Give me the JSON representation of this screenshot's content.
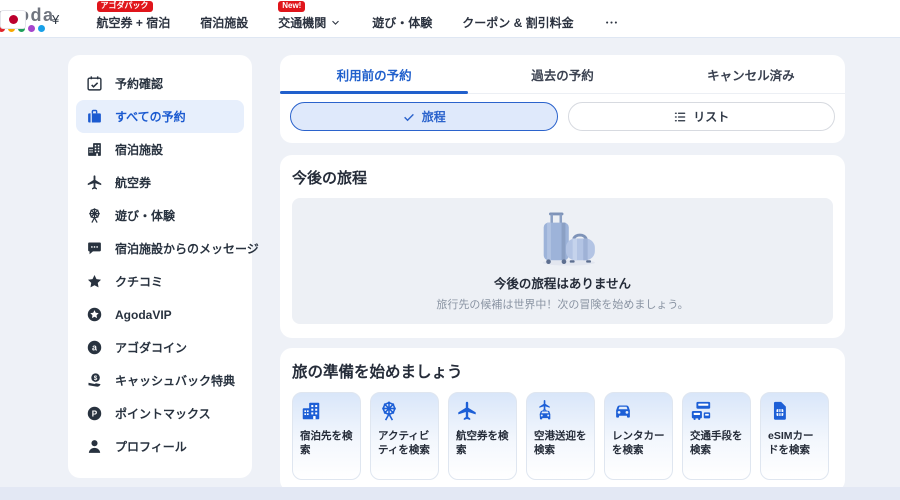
{
  "colors": {
    "accent_blue": "#2160cc",
    "icon_blue": "#1d5fd6",
    "badge_red": "#e0151b",
    "flag_red": "#bc002d",
    "page_bg": "#eef1f7",
    "active_item_bg": "#e7effc",
    "logo_gray": "#70757f",
    "logo_dots": [
      "#e0252c",
      "#f7a800",
      "#1ea05a",
      "#a545cc",
      "#18a0e8"
    ]
  },
  "header": {
    "logo_text": "agoda",
    "nav": [
      {
        "id": "flight-hotel",
        "label": "航空券 + 宿泊",
        "badge": "アゴダパック"
      },
      {
        "id": "hotels",
        "label": "宿泊施設"
      },
      {
        "id": "transport",
        "label": "交通機関",
        "badge": "New!",
        "chevron": true
      },
      {
        "id": "activities",
        "label": "遊び・体験"
      },
      {
        "id": "coupons",
        "label": "クーポン & 割引料金"
      },
      {
        "id": "more",
        "label": "",
        "icon": "more-dots"
      }
    ],
    "locale": {
      "flag": "japan",
      "currency": "¥"
    }
  },
  "sidebar": {
    "items": [
      {
        "icon": "calendar-check",
        "label": "予約確認",
        "active": false
      },
      {
        "icon": "briefcase",
        "label": "すべての予約",
        "active": true
      },
      {
        "icon": "hotel",
        "label": "宿泊施設",
        "active": false
      },
      {
        "icon": "plane",
        "label": "航空券",
        "active": false
      },
      {
        "icon": "ferris-wheel",
        "label": "遊び・体験",
        "active": false
      },
      {
        "icon": "message",
        "label": "宿泊施設からのメッセージ",
        "active": false
      },
      {
        "icon": "star",
        "label": "クチコミ",
        "active": false
      },
      {
        "icon": "vip",
        "label": "AgodaVIP",
        "active": false
      },
      {
        "icon": "coin-a",
        "label": "アゴダコイン",
        "active": false
      },
      {
        "icon": "cashback",
        "label": "キャッシュバック特典",
        "active": false
      },
      {
        "icon": "pointmax",
        "label": "ポイントマックス",
        "active": false
      },
      {
        "icon": "profile",
        "label": "プロフィール",
        "active": false
      }
    ]
  },
  "main": {
    "tabs": [
      {
        "label": "利用前の予約",
        "active": true
      },
      {
        "label": "過去の予約",
        "active": false
      },
      {
        "label": "キャンセル済み",
        "active": false
      }
    ],
    "view_toggle": [
      {
        "label": "旅程",
        "icon": "check",
        "active": true
      },
      {
        "label": "リスト",
        "icon": "list",
        "active": false
      }
    ],
    "upcoming": {
      "title": "今後の旅程",
      "empty_title": "今後の旅程はありません",
      "empty_subtitle": "旅行先の候補は世界中！次の冒険を始めましょう。"
    },
    "prepare": {
      "title": "旅の準備を始めましょう",
      "cards": [
        {
          "icon": "hotel",
          "label": "宿泊先を検索"
        },
        {
          "icon": "ferris-wheel",
          "label": "アクティビティを検索"
        },
        {
          "icon": "plane",
          "label": "航空券を検索"
        },
        {
          "icon": "transfer",
          "label": "空港送迎を検索"
        },
        {
          "icon": "car",
          "label": "レンタカーを検索"
        },
        {
          "icon": "transit",
          "label": "交通手段を検索"
        },
        {
          "icon": "esim",
          "label": "eSIMカードを検索"
        }
      ]
    }
  }
}
